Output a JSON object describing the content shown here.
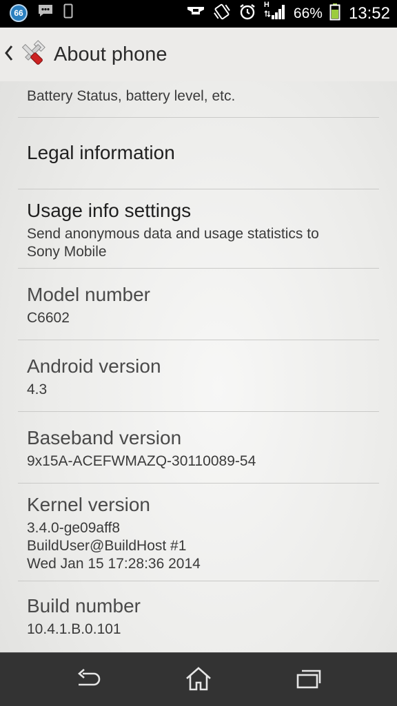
{
  "status_bar": {
    "notification_count": "66",
    "battery_percent": "66%",
    "network_type": "H",
    "time": "13:52",
    "icons": [
      "notification-badge-icon",
      "chat-icon",
      "phone-outline-icon",
      "handset-icon",
      "vibrate-icon",
      "alarm-icon",
      "signal-icon",
      "battery-icon"
    ]
  },
  "action_bar": {
    "title": "About phone"
  },
  "list": {
    "battery_sub": "Battery Status, battery level, etc.",
    "legal": {
      "title": "Legal information"
    },
    "usage": {
      "title": "Usage info settings",
      "sub_line1": "Send anonymous data and usage statistics to",
      "sub_line2": "Sony Mobile"
    },
    "model": {
      "title": "Model number",
      "value": "C6602"
    },
    "android": {
      "title": "Android version",
      "value": "4.3"
    },
    "baseband": {
      "title": "Baseband version",
      "value": "9x15A-ACEFWMAZQ-30110089-54"
    },
    "kernel": {
      "title": "Kernel version",
      "line1": "3.4.0-ge09aff8",
      "line2": "BuildUser@BuildHost #1",
      "line3": "Wed Jan 15 17:28:36 2014"
    },
    "build": {
      "title": "Build number",
      "value": "10.4.1.B.0.101"
    }
  },
  "nav_bar": {
    "buttons": [
      "back-icon",
      "home-icon",
      "recent-apps-icon"
    ]
  }
}
